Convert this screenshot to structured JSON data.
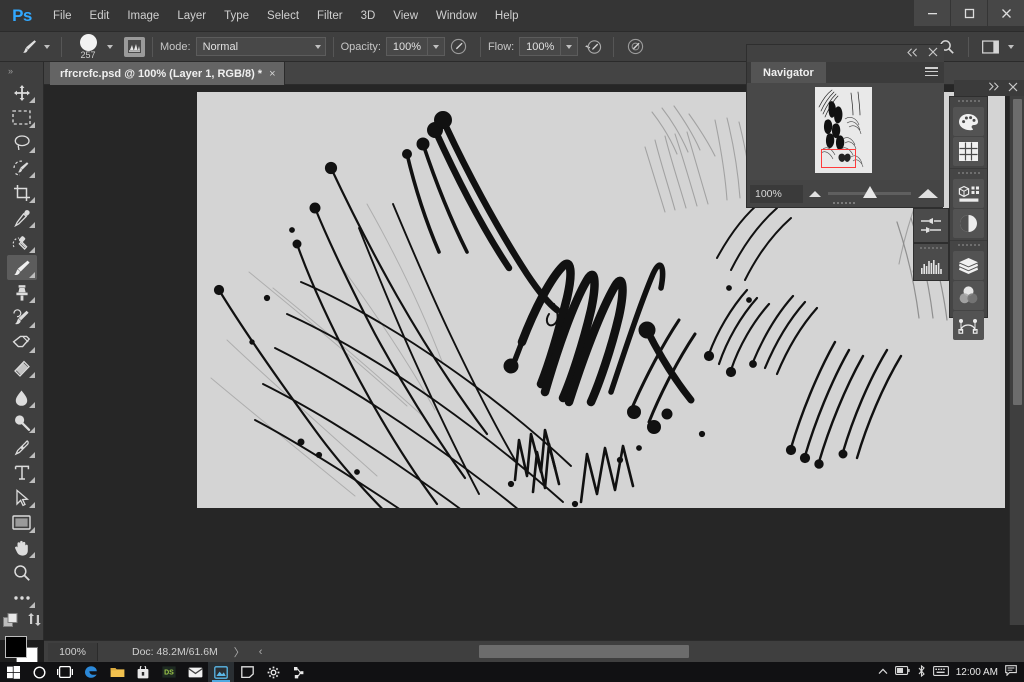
{
  "app": {
    "name": "Adobe Photoshop",
    "logo": "Ps"
  },
  "menubar": {
    "items": [
      {
        "label": "File"
      },
      {
        "label": "Edit"
      },
      {
        "label": "Image"
      },
      {
        "label": "Layer"
      },
      {
        "label": "Type"
      },
      {
        "label": "Select"
      },
      {
        "label": "Filter"
      },
      {
        "label": "3D"
      },
      {
        "label": "View"
      },
      {
        "label": "Window"
      },
      {
        "label": "Help"
      }
    ],
    "window_controls": {
      "minimize": "minimize-icon",
      "maximize": "maximize-icon",
      "close": "close-icon"
    }
  },
  "options_bar": {
    "tool_icon": "brush-tool-icon",
    "brush_size": "257",
    "brush_panel_icon": "brush-settings-icon",
    "mode_label": "Mode:",
    "mode_value": "Normal",
    "opacity_label": "Opacity:",
    "opacity_value": "100%",
    "opacity_pressure_icon": "pressure-opacity-icon",
    "flow_label": "Flow:",
    "flow_value": "100%",
    "airbrush_icon": "airbrush-icon",
    "smoothing_icon": "smoothing-icon",
    "align_right_icon": "workspace-icon",
    "search_icon": "search-icon"
  },
  "document_tab": {
    "title": "rfrcrcfc.psd @ 100% (Layer 1, RGB/8) *",
    "close": "×"
  },
  "toolbar": {
    "handle": "»",
    "tools": [
      {
        "name": "move-tool",
        "icon": "move-icon",
        "active": false
      },
      {
        "name": "rectangular-marquee-tool",
        "icon": "marquee-icon",
        "active": false
      },
      {
        "name": "lasso-tool",
        "icon": "lasso-icon",
        "active": false
      },
      {
        "name": "quick-selection-tool",
        "icon": "quick-select-icon",
        "active": false
      },
      {
        "name": "crop-tool",
        "icon": "crop-icon",
        "active": false
      },
      {
        "name": "eyedropper-tool",
        "icon": "eyedropper-icon",
        "active": false
      },
      {
        "name": "spot-healing-brush-tool",
        "icon": "healing-brush-icon",
        "active": false
      },
      {
        "name": "brush-tool",
        "icon": "brush-icon",
        "active": true
      },
      {
        "name": "clone-stamp-tool",
        "icon": "clone-stamp-icon",
        "active": false
      },
      {
        "name": "history-brush-tool",
        "icon": "history-brush-icon",
        "active": false
      },
      {
        "name": "eraser-tool",
        "icon": "eraser-icon",
        "active": false
      },
      {
        "name": "gradient-tool",
        "icon": "gradient-icon",
        "active": false
      },
      {
        "name": "blur-tool",
        "icon": "blur-droplet-icon",
        "active": false
      },
      {
        "name": "dodge-tool",
        "icon": "dodge-icon",
        "active": false
      },
      {
        "name": "pen-tool",
        "icon": "pen-icon",
        "active": false
      },
      {
        "name": "type-tool",
        "icon": "type-icon",
        "active": false
      },
      {
        "name": "path-selection-tool",
        "icon": "path-arrow-icon",
        "active": false
      },
      {
        "name": "rectangle-tool",
        "icon": "rectangle-icon",
        "active": false
      },
      {
        "name": "hand-tool",
        "icon": "hand-icon",
        "active": false
      },
      {
        "name": "zoom-tool",
        "icon": "zoom-magnifier-icon",
        "active": false
      },
      {
        "name": "edit-toolbar-tool",
        "icon": "ellipsis-icon",
        "active": false
      }
    ],
    "foreground_color": "#000000",
    "background_color": "#ffffff"
  },
  "navigator": {
    "title": "Navigator",
    "collapse_icon": "collapse-double-chevron-icon",
    "close_icon": "close-icon",
    "menu_icon": "panel-menu-icon",
    "zoom_value": "100%",
    "viewbox_color": "#ff3b3b",
    "small_mountain_icon": "zoom-out-icon",
    "large_mountain_icon": "zoom-in-icon"
  },
  "right_dock": {
    "expand_icon": "expand-double-chevron-icon",
    "close_icon": "close-icon",
    "groups": [
      {
        "panels": [
          {
            "name": "color-panel",
            "icon": "color-palette-icon"
          },
          {
            "name": "swatches-panel",
            "icon": "swatches-grid-icon"
          }
        ]
      },
      {
        "panels": [
          {
            "name": "properties-panel",
            "icon": "properties-icon"
          },
          {
            "name": "adjustments-panel",
            "icon": "adjustments-half-circle-icon"
          }
        ]
      },
      {
        "panels": [
          {
            "name": "layers-panel",
            "icon": "layers-stack-icon"
          },
          {
            "name": "channels-panel",
            "icon": "channels-venn-icon"
          },
          {
            "name": "paths-panel",
            "icon": "paths-bezier-icon"
          }
        ]
      }
    ],
    "collapsed_panels": [
      {
        "name": "brush-settings-panel",
        "icon": "brush-settings-slider-icon"
      },
      {
        "name": "histogram-panel",
        "icon": "histogram-icon"
      }
    ]
  },
  "canvas": {
    "background_color": "#262626",
    "artboard_color": "#d4d4d4",
    "zoom": "100%"
  },
  "status_bar": {
    "zoom": "100%",
    "doc_info": "Doc: 48.2M/61.6M",
    "forward_arrow": "〉",
    "back_arrow": "‹"
  },
  "taskbar": {
    "items": [
      {
        "name": "start-button",
        "icon": "windows-start-icon",
        "active": false
      },
      {
        "name": "cortana-search",
        "icon": "circle-search-icon",
        "active": false
      },
      {
        "name": "task-view",
        "icon": "task-view-icon",
        "active": false
      },
      {
        "name": "edge-browser",
        "icon": "edge-icon",
        "active": false
      },
      {
        "name": "file-explorer",
        "icon": "folder-icon",
        "active": false
      },
      {
        "name": "microsoft-store",
        "icon": "store-bag-icon",
        "active": false
      },
      {
        "name": "ds-app",
        "icon": "ds-icon",
        "active": false
      },
      {
        "name": "mail-app",
        "icon": "mail-envelope-icon",
        "active": false
      },
      {
        "name": "photos-app",
        "icon": "photos-icon",
        "active": true
      },
      {
        "name": "sticky-notes",
        "icon": "sticky-note-icon",
        "active": false
      },
      {
        "name": "settings-app",
        "icon": "gear-icon",
        "active": false
      },
      {
        "name": "photoshop-app",
        "icon": "photoshop-taskbar-icon",
        "active": false
      }
    ],
    "tray": {
      "chevron": "show-hidden-icons",
      "battery": "battery-icon",
      "bluetooth": "bluetooth-icon",
      "keyboard": "keyboard-icon",
      "time": "12:00 AM",
      "notifications": "notification-icon"
    }
  }
}
